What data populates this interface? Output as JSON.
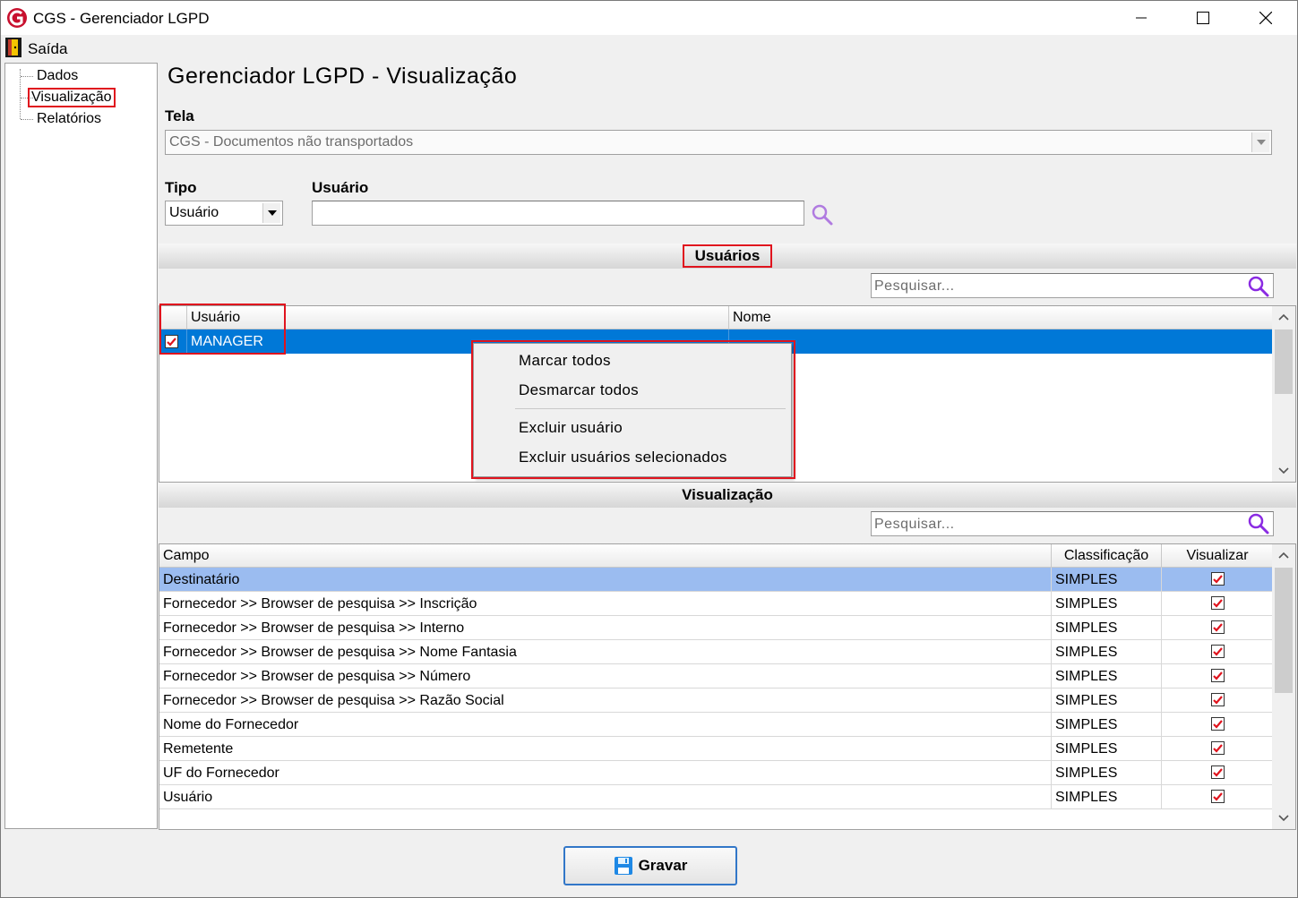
{
  "window": {
    "title": "CGS - Gerenciador LGPD",
    "minimize_glyph": "—",
    "close_glyph": "✕"
  },
  "menu": {
    "exit_label": "Saída"
  },
  "nav": {
    "items": [
      {
        "label": "Dados"
      },
      {
        "label": "Visualização"
      },
      {
        "label": "Relatórios"
      }
    ]
  },
  "page": {
    "title": "Gerenciador LGPD - Visualização"
  },
  "tela": {
    "label": "Tela",
    "value": "CGS - Documentos não transportados"
  },
  "tipo": {
    "label": "Tipo",
    "value": "Usuário"
  },
  "usuario": {
    "label": "Usuário",
    "value": ""
  },
  "users_section": {
    "title": "Usuários",
    "search_placeholder": "Pesquisar...",
    "columns": [
      "Usuário",
      "Nome"
    ],
    "rows": [
      {
        "checked": true,
        "usuario": "MANAGER",
        "nome": ""
      }
    ]
  },
  "context_menu": {
    "items": [
      "Marcar todos",
      "Desmarcar todos",
      "Excluir usuário",
      "Excluir usuários selecionados"
    ]
  },
  "visual_section": {
    "title": "Visualização",
    "search_placeholder": "Pesquisar...",
    "columns": [
      "Campo",
      "Classificação",
      "Visualizar"
    ],
    "rows": [
      {
        "campo": "Destinatário",
        "classificacao": "SIMPLES",
        "visualizar": true
      },
      {
        "campo": "Fornecedor >> Browser de pesquisa >> Inscrição",
        "classificacao": "SIMPLES",
        "visualizar": true
      },
      {
        "campo": "Fornecedor >> Browser de pesquisa >> Interno",
        "classificacao": "SIMPLES",
        "visualizar": true
      },
      {
        "campo": "Fornecedor >> Browser de pesquisa >> Nome Fantasia",
        "classificacao": "SIMPLES",
        "visualizar": true
      },
      {
        "campo": "Fornecedor >> Browser de pesquisa >> Número",
        "classificacao": "SIMPLES",
        "visualizar": true
      },
      {
        "campo": "Fornecedor >> Browser de pesquisa >> Razão Social",
        "classificacao": "SIMPLES",
        "visualizar": true
      },
      {
        "campo": "Nome do Fornecedor",
        "classificacao": "SIMPLES",
        "visualizar": true
      },
      {
        "campo": "Remetente",
        "classificacao": "SIMPLES",
        "visualizar": true
      },
      {
        "campo": "UF do Fornecedor",
        "classificacao": "SIMPLES",
        "visualizar": true
      },
      {
        "campo": "Usuário",
        "classificacao": "SIMPLES",
        "visualizar": true
      }
    ]
  },
  "footer": {
    "save_label": "Gravar"
  },
  "colors": {
    "highlight": "#e0141e",
    "selection": "#0078d7",
    "selected_row": "#9bbcf0",
    "search_icon": "#8a2be2"
  }
}
